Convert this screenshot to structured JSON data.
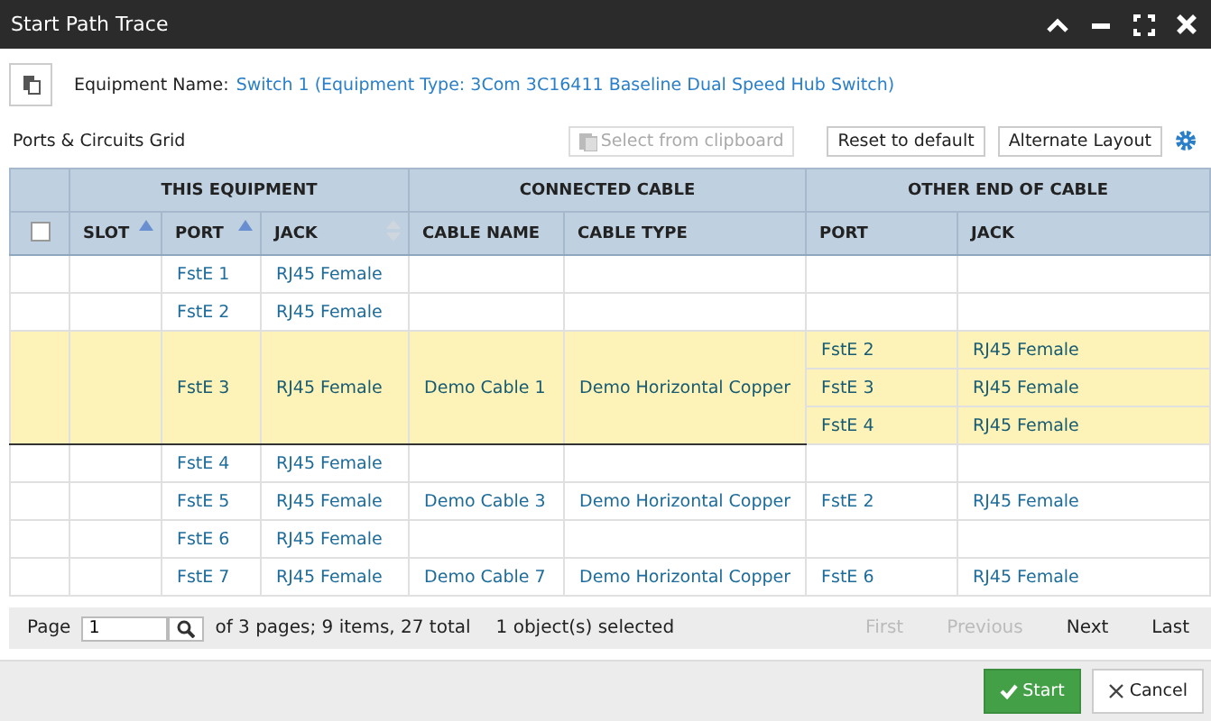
{
  "window": {
    "title": "Start Path Trace"
  },
  "equipment": {
    "label": "Equipment Name:",
    "value": "Switch 1 (Equipment Type: 3Com 3C16411 Baseline Dual Speed Hub Switch)"
  },
  "grid_title": "Ports & Circuits Grid",
  "toolbar": [
    {
      "label": "Select from clipboard",
      "disabled": true
    },
    {
      "label": "Reset to default",
      "disabled": false
    },
    {
      "label": "Alternate Layout",
      "disabled": false
    }
  ],
  "groups": [
    "THIS EQUIPMENT",
    "CONNECTED CABLE",
    "OTHER END OF CABLE"
  ],
  "select_all_checked": false,
  "columns": [
    {
      "label": "SLOT",
      "sorted": true
    },
    {
      "label": "PORT",
      "sorted": true
    },
    {
      "label": "JACK",
      "sorted": false
    },
    {
      "label": "CABLE NAME"
    },
    {
      "label": "CABLE TYPE"
    },
    {
      "label": "PORT"
    },
    {
      "label": "JACK"
    }
  ],
  "rows": [
    {
      "selected": false,
      "port": "FstE 1",
      "jack": "RJ45 Female"
    },
    {
      "selected": false,
      "port": "FstE 2",
      "jack": "RJ45 Female"
    },
    {
      "selected": true,
      "port": "FstE 3",
      "jack": "RJ45 Female",
      "cable_name": "Demo Cable 1",
      "cable_type": "Demo Horizontal Copper",
      "ends": [
        {
          "port": "FstE 2",
          "jack": "RJ45 Female"
        },
        {
          "port": "FstE 3",
          "jack": "RJ45 Female"
        },
        {
          "port": "FstE 4",
          "jack": "RJ45 Female"
        }
      ]
    },
    {
      "selected": false,
      "port": "FstE 4",
      "jack": "RJ45 Female"
    },
    {
      "selected": false,
      "port": "FstE 5",
      "jack": "RJ45 Female",
      "cable_name": "Demo Cable 3",
      "cable_type": "Demo Horizontal Copper",
      "ends": [
        {
          "port": "FstE 2",
          "jack": "RJ45 Female"
        }
      ]
    },
    {
      "selected": false,
      "port": "FstE 6",
      "jack": "RJ45 Female"
    },
    {
      "selected": false,
      "port": "FstE 7",
      "jack": "RJ45 Female",
      "cable_name": "Demo Cable 7",
      "cable_type": "Demo Horizontal Copper",
      "ends": [
        {
          "port": "FstE 6",
          "jack": "RJ45 Female"
        }
      ]
    }
  ],
  "pager": {
    "page_label": "Page",
    "page": "1",
    "summary": "of 3 pages; 9 items, 27 total",
    "selection": "1 object(s) selected",
    "links": [
      {
        "label": "First",
        "disabled": true
      },
      {
        "label": "Previous",
        "disabled": true
      },
      {
        "label": "Next",
        "disabled": false
      },
      {
        "label": "Last",
        "disabled": false
      }
    ]
  },
  "buttons": [
    {
      "kind": "primary",
      "label": "Start"
    },
    {
      "kind": "cancel",
      "label": "Cancel"
    }
  ]
}
